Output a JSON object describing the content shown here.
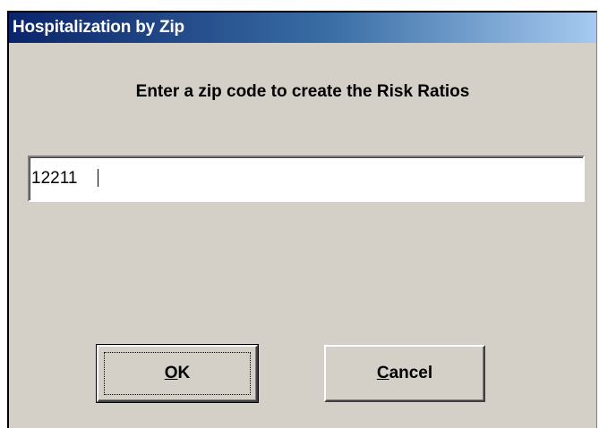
{
  "window": {
    "title": "Hospitalization by Zip"
  },
  "dialog": {
    "prompt": "Enter a zip code to create the Risk Ratios",
    "zip_input": {
      "value": "12211",
      "placeholder": ""
    }
  },
  "buttons": {
    "ok": {
      "accel": "O",
      "rest": "K"
    },
    "cancel": {
      "accel": "C",
      "rest": "ancel"
    }
  },
  "colors": {
    "dialog_face": "#d4d0c8",
    "title_gradient_start": "#0a246a",
    "title_gradient_end": "#a6caf0",
    "title_text": "#ffffff"
  }
}
